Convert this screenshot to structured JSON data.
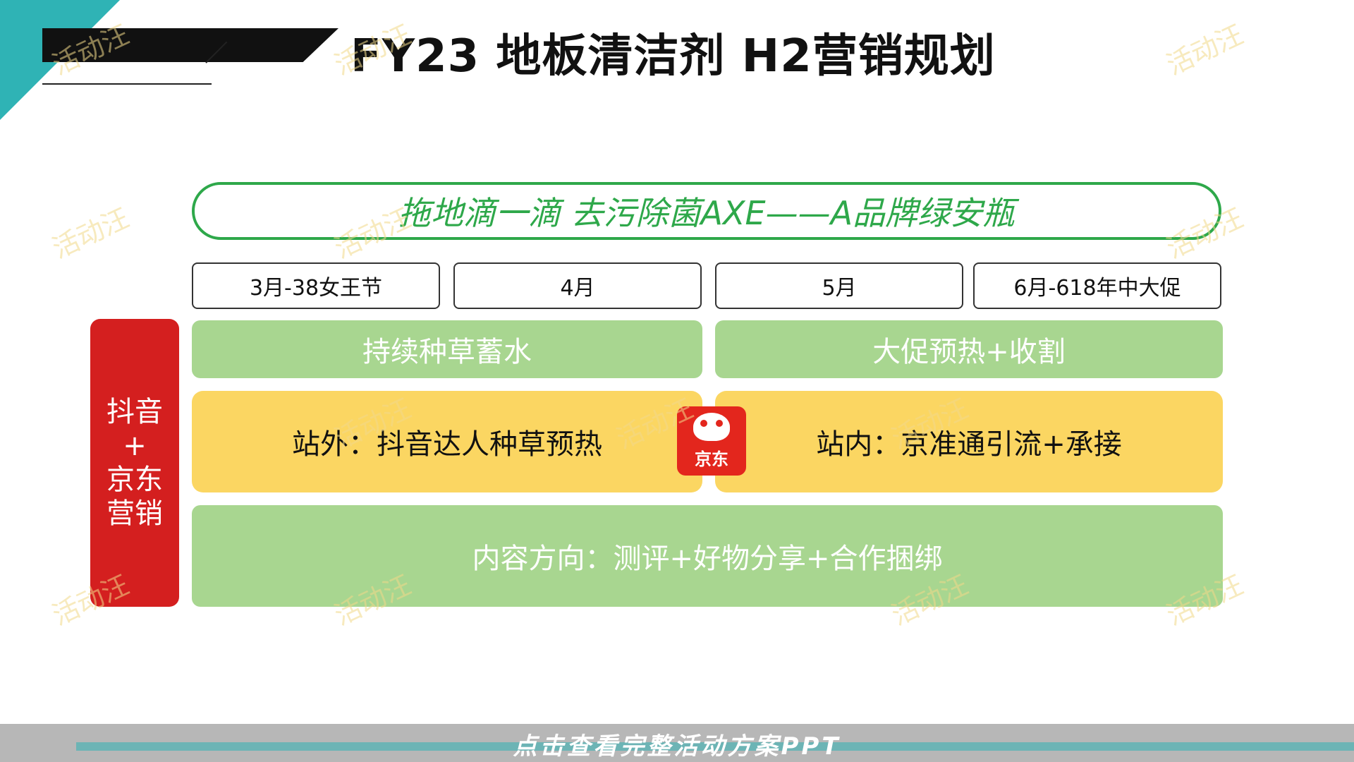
{
  "header": {
    "title": "FY23 地板清洁剂 H2营销规划"
  },
  "slogan": "拖地滴一滴 去污除菌AXE——A品牌绿安瓶",
  "months": [
    "3月-38女王节",
    "4月",
    "5月",
    "6月-618年中大促"
  ],
  "side_label": {
    "line1": "抖音",
    "line2": "+",
    "line3": "京东",
    "line4": "营销"
  },
  "phases": {
    "left": "持续种草蓄水",
    "right": "大促预热+收割"
  },
  "channels": {
    "left": "站外：抖音达人种草预热",
    "right": "站内：京准通引流+承接",
    "logo_text": "京东"
  },
  "content": "内容方向：测评+好物分享+合作捆绑",
  "footer": {
    "link": "点击查看完整活动方案PPT"
  },
  "watermark": "活动汪",
  "colors": {
    "teal": "#2fb3b5",
    "green": "#2ea84a",
    "light_green": "#a8d690",
    "yellow": "#fbd662",
    "red": "#d41f1f"
  }
}
